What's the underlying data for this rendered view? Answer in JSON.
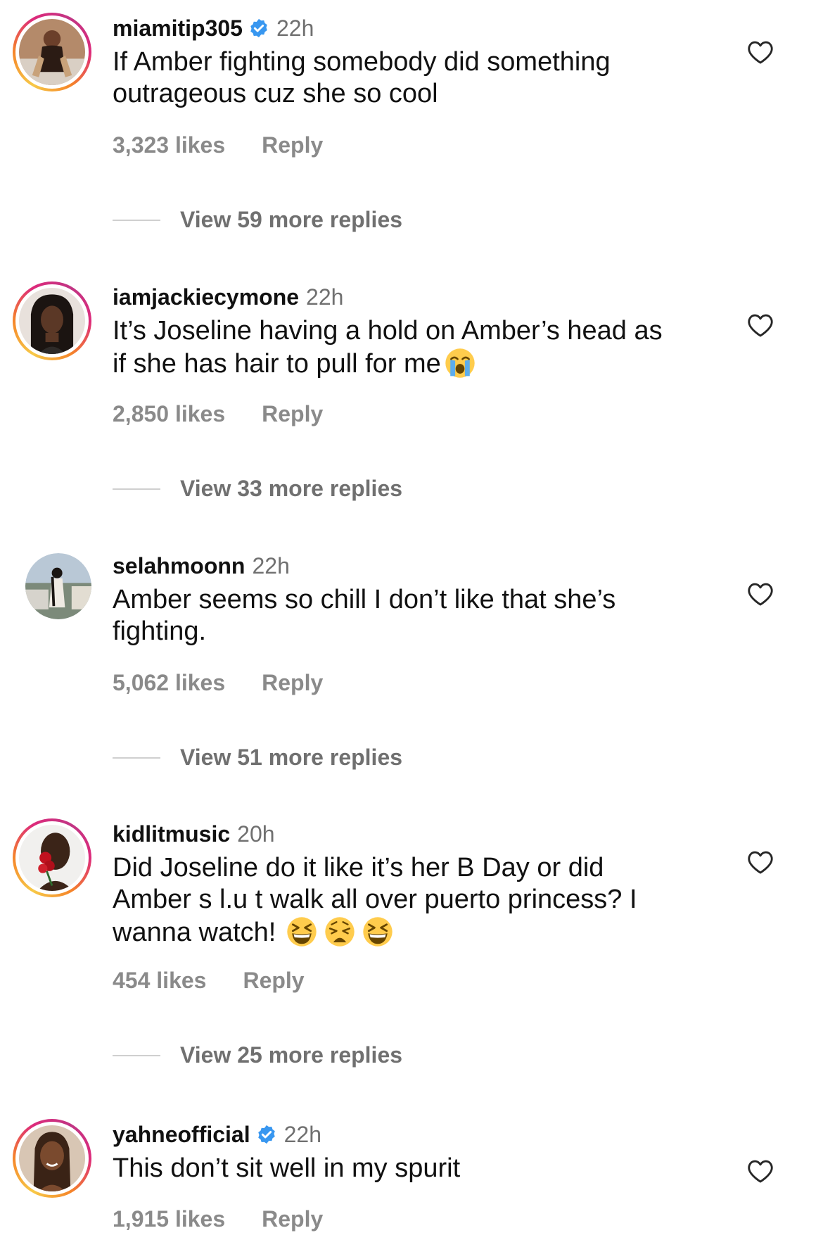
{
  "comments": [
    {
      "username": "miamitip305",
      "verified": true,
      "time": "22h",
      "text": "If Amber fighting somebody did something\noutrageous cuz she so cool",
      "emojis": [],
      "likes": "3,323 likes",
      "reply_label": "Reply",
      "view_replies": "View 59 more replies",
      "has_story_ring": true
    },
    {
      "username": "iamjackiecymone",
      "verified": false,
      "time": "22h",
      "text": "It’s Joseline having a hold on Amber’s head as\nif she has hair to pull for me",
      "emojis": [
        "loudly-crying-face-emoji"
      ],
      "likes": "2,850 likes",
      "reply_label": "Reply",
      "view_replies": "View 33 more replies",
      "has_story_ring": true
    },
    {
      "username": "selahmoonn",
      "verified": false,
      "time": "22h",
      "text": "Amber seems so chill I don’t like that she’s\nfighting.",
      "emojis": [],
      "likes": "5,062 likes",
      "reply_label": "Reply",
      "view_replies": "View 51 more replies",
      "has_story_ring": false
    },
    {
      "username": "kidlitmusic",
      "verified": false,
      "time": "20h",
      "text": "Did Joseline do it like it’s her B Day or did\nAmber s l.u t walk all over puerto princess? I\nwanna watch!",
      "emojis": [
        "grinning-squinting-face-emoji",
        "weary-face-emoji",
        "grinning-squinting-face-emoji"
      ],
      "likes": "454 likes",
      "reply_label": "Reply",
      "view_replies": "View 25 more replies",
      "has_story_ring": true
    },
    {
      "username": "yahneofficial",
      "verified": true,
      "time": "22h",
      "text": "This don’t sit well in my spurit",
      "emojis": [],
      "likes": "1,915 likes",
      "reply_label": "Reply",
      "view_replies": "",
      "has_story_ring": true
    }
  ],
  "icons": {
    "like": "heart-outline-icon",
    "verified": "verified-badge-icon"
  },
  "colors": {
    "text": "#111111",
    "secondary": "#8a8a8a",
    "verified": "#3897f0",
    "ring_start": "#f7c948",
    "ring_end": "#c13584"
  }
}
